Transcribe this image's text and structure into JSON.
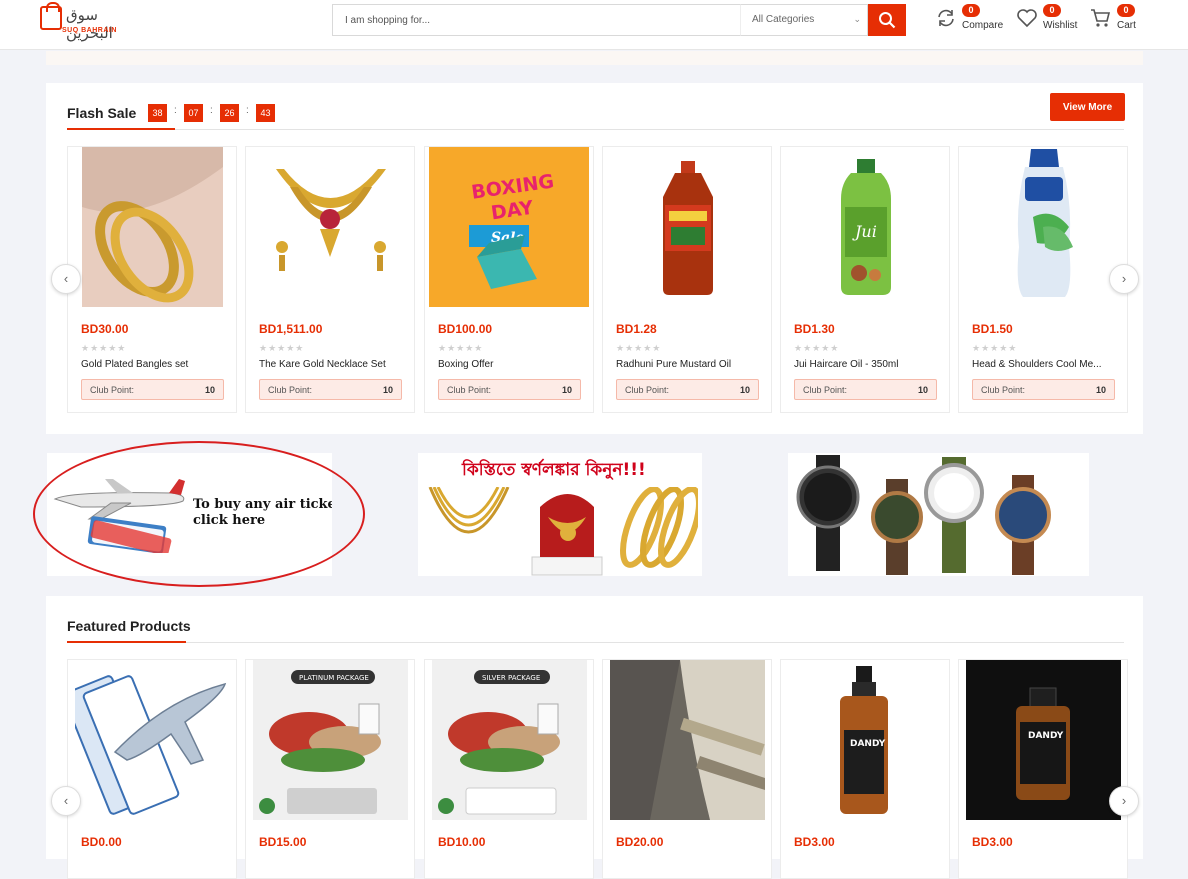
{
  "header": {
    "logo_arabic": "سوق البحرين",
    "logo_text": "SUQ BAHRAIN",
    "search_placeholder": "I am shopping for...",
    "category_select": "All Categories",
    "compare": {
      "label": "Compare",
      "count": "0"
    },
    "wishlist": {
      "label": "Wishlist",
      "count": "0"
    },
    "cart": {
      "label": "Cart",
      "count": "0"
    }
  },
  "flash_sale": {
    "title": "Flash Sale",
    "timer": [
      "38",
      "07",
      "26",
      "43"
    ],
    "view_more": "View More",
    "products": [
      {
        "price": "BD30.00",
        "name": "Gold Plated Bangles set",
        "club_label": "Club Point:",
        "club_value": "10",
        "icon": "bangles-image"
      },
      {
        "price": "BD1,511.00",
        "name": "The Kare Gold Necklace Set",
        "club_label": "Club Point:",
        "club_value": "10",
        "icon": "necklace-image"
      },
      {
        "price": "BD100.00",
        "name": "Boxing Offer",
        "club_label": "Club Point:",
        "club_value": "10",
        "icon": "boxing-day-image"
      },
      {
        "price": "BD1.28",
        "name": "Radhuni Pure Mustard Oil",
        "club_label": "Club Point:",
        "club_value": "10",
        "icon": "mustard-oil-image"
      },
      {
        "price": "BD1.30",
        "name": "Jui Haircare Oil - 350ml",
        "club_label": "Club Point:",
        "club_value": "10",
        "icon": "hair-oil-image"
      },
      {
        "price": "BD1.50",
        "name": "Head & Shoulders Cool Me...",
        "club_label": "Club Point:",
        "club_value": "10",
        "icon": "shampoo-image"
      }
    ]
  },
  "banners": {
    "air_ticket_text": "To buy any air ticket click here",
    "gold_text": "কিস্তিতে স্বর্ণলঙ্কার কিনুন!!!"
  },
  "boxing_image_text": {
    "line1": "BOXING",
    "line2": "DAY",
    "line3": "Sale"
  },
  "featured": {
    "title": "Featured Products",
    "products": [
      {
        "price": "BD0.00",
        "icon": "air-ticket-image"
      },
      {
        "price": "BD15.00",
        "icon": "platinum-package-image",
        "badge": "PLATINUM PACKAGE"
      },
      {
        "price": "BD10.00",
        "icon": "silver-package-image",
        "badge": "SILVER PACKAGE"
      },
      {
        "price": "BD20.00",
        "icon": "thobe-image"
      },
      {
        "price": "BD3.00",
        "icon": "dandy-spray-image"
      },
      {
        "price": "BD3.00",
        "icon": "dandy-bottle-image"
      }
    ]
  },
  "colors": {
    "accent": "#e62e04",
    "highlight": "#d81e1e"
  }
}
